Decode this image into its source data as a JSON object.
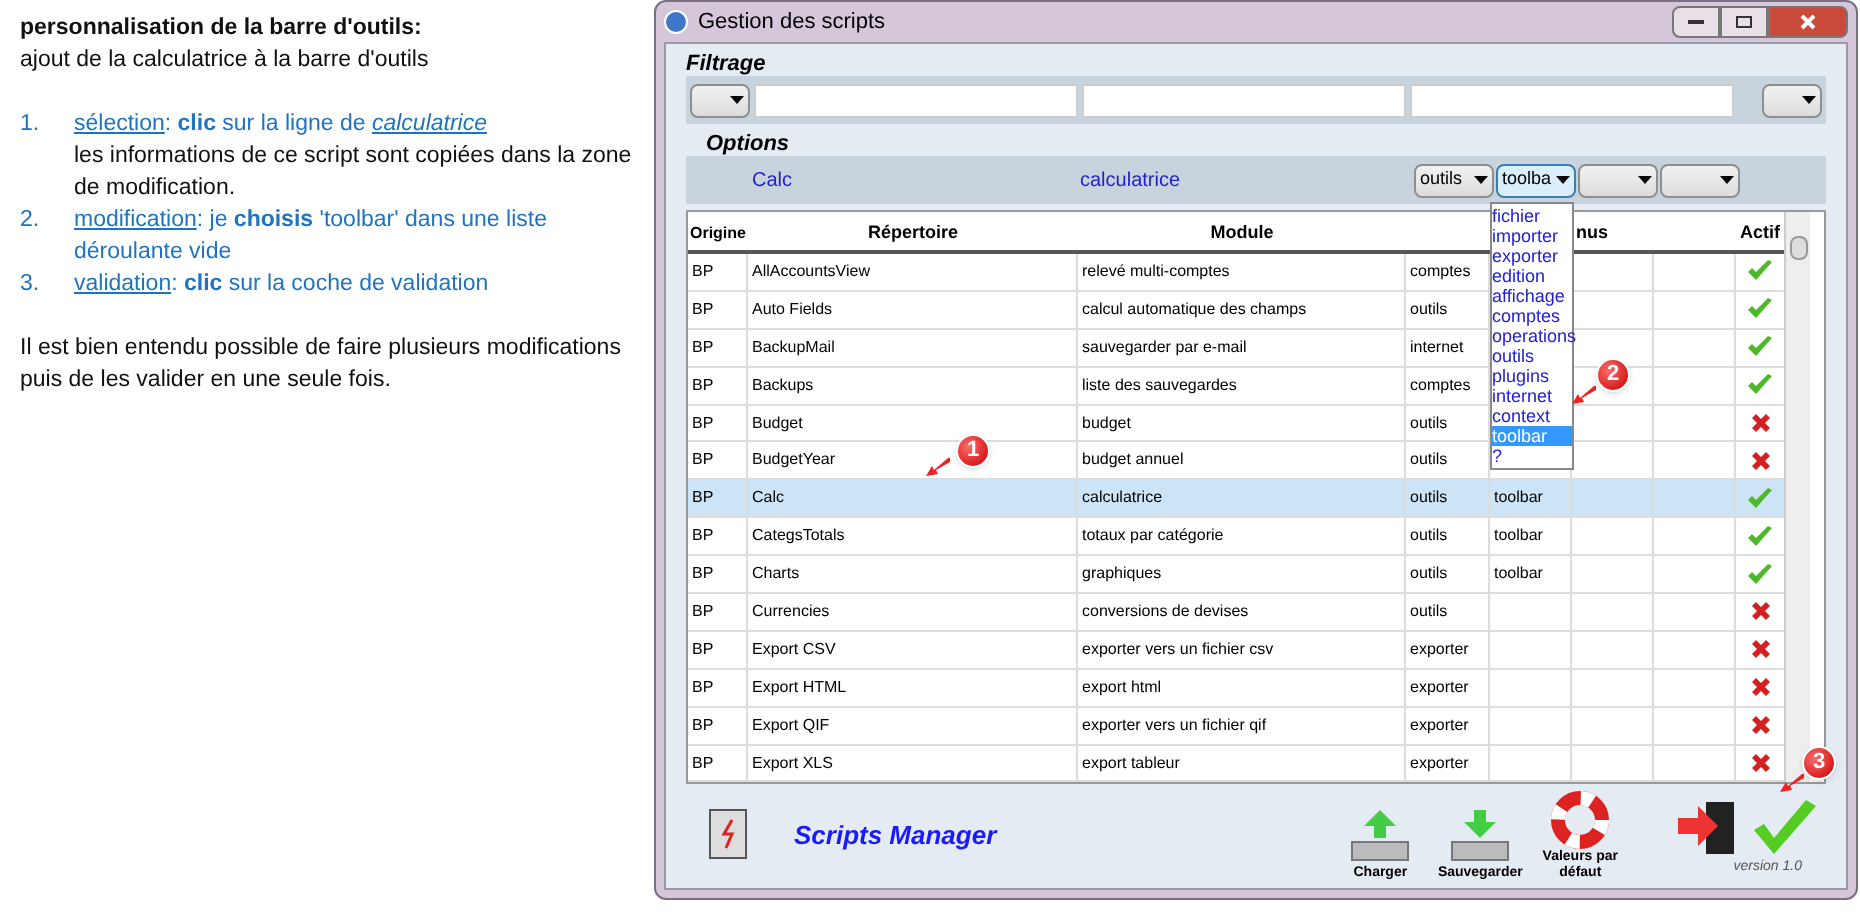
{
  "instructions": {
    "title": "personnalisation de la barre d'outils:",
    "subtitle": "ajout de la calculatrice à la barre d'outils",
    "steps": [
      {
        "number": "1.",
        "link": "sélection",
        "text": ": **clic** sur la ligne de ",
        "link2": "calculatrice",
        "note": "les informations de ce script sont copiées dans la zone de modification."
      },
      {
        "number": "2.",
        "link": "modification",
        "text": ": je **choisis** 'toolbar' dans une liste déroulante vide"
      },
      {
        "number": "3.",
        "link": "validation",
        "text": ": **clic** sur la coche de validation"
      }
    ],
    "footer": "Il est bien entendu possible de faire plusieurs modifications puis de les valider en une seule fois."
  },
  "window": {
    "title": "Gestion des scripts"
  },
  "filter": {
    "title": "Filtrage"
  },
  "options": {
    "title": "Options",
    "name": "Calc",
    "module": "calculatrice",
    "selects": [
      {
        "value": "outils",
        "open": false
      },
      {
        "value": "toolba",
        "open": true
      },
      {
        "open": false
      },
      {
        "open": false
      }
    ]
  },
  "dropdown": {
    "items": [
      {
        "label": "fichier",
        "selected": false
      },
      {
        "label": "importer",
        "selected": false
      },
      {
        "label": "exporter",
        "selected": false
      },
      {
        "label": "edition",
        "selected": false
      },
      {
        "label": "affichage",
        "selected": false
      },
      {
        "label": "comptes",
        "selected": false
      },
      {
        "label": "operations",
        "selected": false
      },
      {
        "label": "outils",
        "selected": false
      },
      {
        "label": "plugins",
        "selected": false
      },
      {
        "label": "internet",
        "selected": false
      },
      {
        "label": "context",
        "selected": false
      },
      {
        "label": "toolbar",
        "selected": true
      },
      {
        "label": "?",
        "selected": false
      }
    ]
  },
  "table": {
    "columns": [
      "Origine",
      "Répertoire",
      "Module",
      "nus",
      "Actif"
    ],
    "rows": [
      {
        "cells": [
          "BP",
          "AllAccountsView",
          "relevé multi-comptes",
          "comptes",
          ""
        ],
        "active": true,
        "selected": false
      },
      {
        "cells": [
          "BP",
          "Auto Fields",
          "calcul automatique des champs",
          "outils",
          ""
        ],
        "active": true,
        "selected": false
      },
      {
        "cells": [
          "BP",
          "BackupMail",
          "sauvegarder par e-mail",
          "internet",
          ""
        ],
        "active": true,
        "selected": false
      },
      {
        "cells": [
          "BP",
          "Backups",
          "liste des sauvegardes",
          "comptes",
          ""
        ],
        "active": true,
        "selected": false
      },
      {
        "cells": [
          "BP",
          "Budget",
          "budget",
          "outils",
          ""
        ],
        "active": false,
        "selected": false
      },
      {
        "cells": [
          "BP",
          "BudgetYear",
          "budget annuel",
          "outils",
          ""
        ],
        "active": false,
        "selected": false
      },
      {
        "cells": [
          "BP",
          "Calc",
          "calculatrice",
          "outils",
          "toolbar"
        ],
        "active": true,
        "selected": true
      },
      {
        "cells": [
          "BP",
          "CategsTotals",
          "totaux par catégorie",
          "outils",
          "toolbar"
        ],
        "active": true,
        "selected": false
      },
      {
        "cells": [
          "BP",
          "Charts",
          "graphiques",
          "outils",
          "toolbar"
        ],
        "active": true,
        "selected": false
      },
      {
        "cells": [
          "BP",
          "Currencies",
          "conversions de devises",
          "outils",
          ""
        ],
        "active": false,
        "selected": false
      },
      {
        "cells": [
          "BP",
          "Export CSV",
          "exporter vers un fichier csv",
          "exporter",
          ""
        ],
        "active": false,
        "selected": false
      },
      {
        "cells": [
          "BP",
          "Export HTML",
          "export html",
          "exporter",
          ""
        ],
        "active": false,
        "selected": false
      },
      {
        "cells": [
          "BP",
          "Export QIF",
          "exporter vers un fichier qif",
          "exporter",
          ""
        ],
        "active": false,
        "selected": false
      },
      {
        "cells": [
          "BP",
          "Export XLS",
          "export tableur",
          "exporter",
          ""
        ],
        "active": false,
        "selected": false
      }
    ]
  },
  "callouts": [
    "1",
    "2",
    "3"
  ],
  "footer": {
    "app_name": "Scripts Manager",
    "buttons": [
      "Charger",
      "Sauvegarder",
      "Valeurs par défaut"
    ],
    "version": "version 1.0"
  }
}
